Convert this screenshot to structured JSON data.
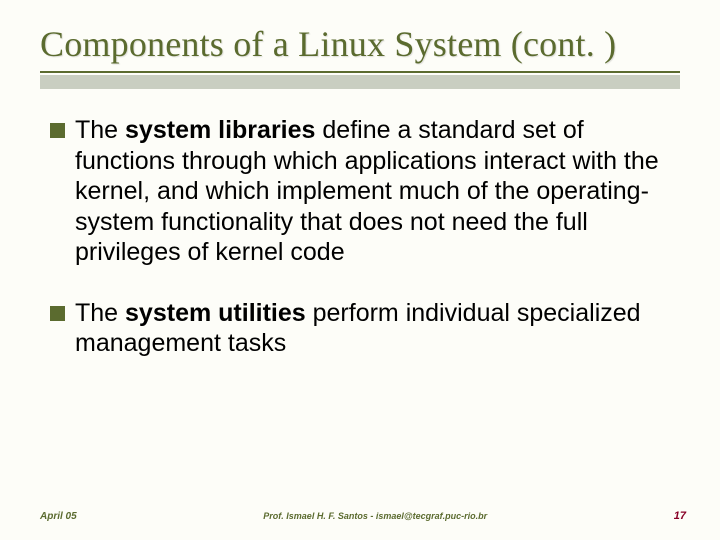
{
  "title": "Components of a Linux System (cont. )",
  "bullets": [
    {
      "lead": "The ",
      "bold": "system libraries",
      "rest": " define a standard set of functions through which applications interact with the kernel, and which implement much of the operating-system functionality that does not need the full privileges of kernel code"
    },
    {
      "lead": "The ",
      "bold": "system utilities",
      "rest": " perform individual specialized management tasks"
    }
  ],
  "footer": {
    "date": "April 05",
    "author": "Prof. Ismael H. F. Santos  -  ismael@tecgraf.puc-rio.br",
    "page": "17"
  }
}
